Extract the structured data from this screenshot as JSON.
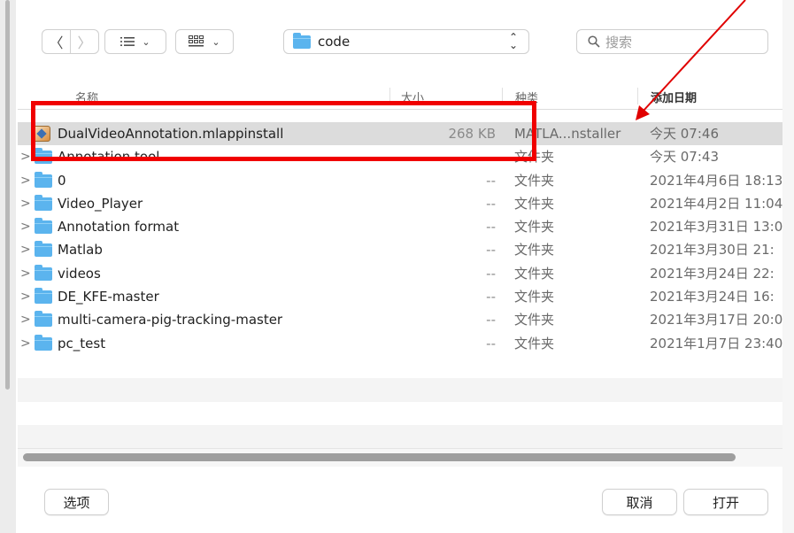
{
  "toolbar": {
    "back_icon": "chevron-left-icon",
    "forward_icon": "chevron-right-icon",
    "folder_popup_label": "code",
    "search_placeholder": "搜索"
  },
  "columns": {
    "name": "名称",
    "size": "大小",
    "kind": "种类",
    "date_added": "添加日期"
  },
  "files": [
    {
      "name": "DualVideoAnnotation.mlappinstall",
      "size": "268 KB",
      "kind": "MATLA...nstaller",
      "date": "今天 07:46",
      "icon": "app-installer-icon",
      "selected": true
    },
    {
      "name": "Annotation tool",
      "size": "--",
      "kind": "文件夹",
      "date": "今天 07:43",
      "icon": "folder-icon"
    },
    {
      "name": "0",
      "size": "--",
      "kind": "文件夹",
      "date": "2021年4月6日 18:13",
      "icon": "folder-icon"
    },
    {
      "name": "Video_Player",
      "size": "--",
      "kind": "文件夹",
      "date": "2021年4月2日 11:04",
      "icon": "folder-icon"
    },
    {
      "name": "Annotation format",
      "size": "--",
      "kind": "文件夹",
      "date": "2021年3月31日 13:0",
      "icon": "folder-icon"
    },
    {
      "name": "Matlab",
      "size": "--",
      "kind": "文件夹",
      "date": "2021年3月30日 21:",
      "icon": "folder-icon"
    },
    {
      "name": "videos",
      "size": "--",
      "kind": "文件夹",
      "date": "2021年3月24日 22:",
      "icon": "folder-icon"
    },
    {
      "name": "DE_KFE-master",
      "size": "--",
      "kind": "文件夹",
      "date": "2021年3月24日 16:",
      "icon": "folder-icon"
    },
    {
      "name": "multi-camera-pig-tracking-master",
      "size": "--",
      "kind": "文件夹",
      "date": "2021年3月17日 20:0",
      "icon": "folder-icon"
    },
    {
      "name": "pc_test",
      "size": "--",
      "kind": "文件夹",
      "date": "2021年1月7日 23:40",
      "icon": "folder-icon"
    }
  ],
  "buttons": {
    "options": "选项",
    "cancel": "取消",
    "open": "打开"
  },
  "annotation": {
    "highlight_color": "#f00000",
    "arrow_color": "#e00000"
  }
}
